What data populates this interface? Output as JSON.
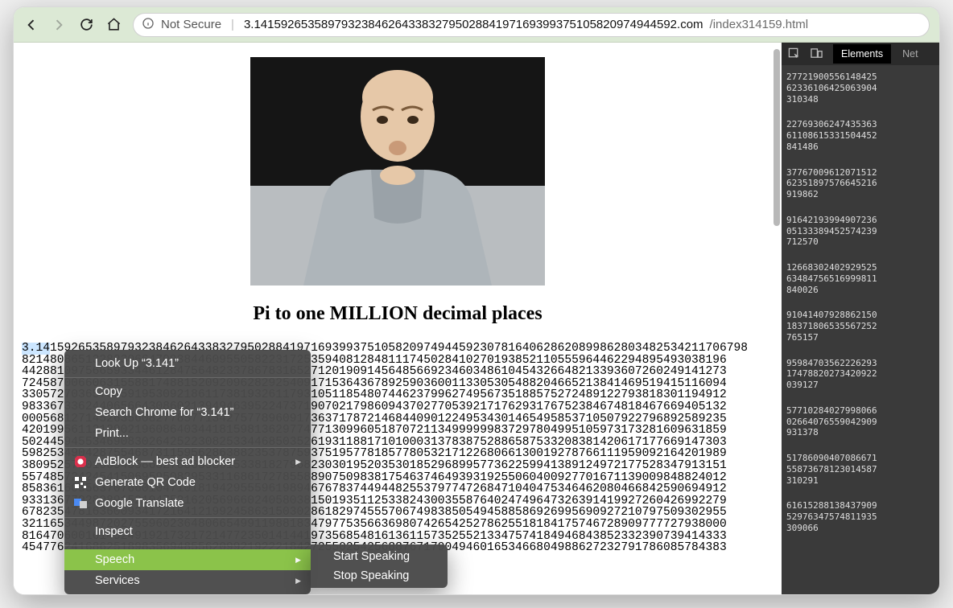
{
  "toolbar": {
    "not_secure": "Not Secure",
    "host": "3.141592653589793238462643383279502884197169399375105820974944592.com",
    "path": "/index314159.html"
  },
  "page": {
    "title": "Pi to one MILLION decimal places",
    "selection": "3.14",
    "digit_rows": [
      "159265358979323846264338327950288419716939937510582097494459230781640628620899862803482534211706798",
      "8214808651328230664709384460955058223172535940812848111745028410270193852110555964462294895493038196",
      "4428810975665933446128475648233786783165271201909145648566923460348610454326648213393607260249141273",
      "7245870066063155881748815209209628292540917153643678925903600113305305488204665213841469519415116094",
      "3305727036575959195309218611738193261179310511854807446237996274956735188575272489122793818301194912",
      "9833673362440656643086021394946395224737190702179860943702770539217176293176752384674818467669405132",
      "0005681271452635608277857713427577896091736371787214684409012249534301465495853710507922796892589235",
      "4201995611212902196086403441815981362977477130996051870721134999999837297804995105973173281609631859",
      "5024459455346908302642522308253344685035261931188171010003137838752886587533208381420617177669147303",
      "5982534904287554687311595628638823537875937519577818577805321712268066130019278766111959092164201989",
      "3809525720106548586327886593615338182796823030195203530185296899577362259941389124972177528347913151",
      "5574857242454150695950829533116861727855889075098381754637464939319255060400927701671139009848824012",
      "8583616035637076601047101819429555961989467678374494482553797747268471040475346462080466842590694912",
      "9331367702898915210475216205696602405803815019351125338243003558764024749647326391419927260426992279",
      "6782354781636009341721641219924586315030286182974555706749838505494588586926995690927210797509302955",
      "3211653449872027559602364806654991198818347977535663698074265425278625518184175746728909777727938000",
      "8164706001614524919217321721477235014144197356854816136115735255213347574184946843852332390739414333",
      "4547762416862518983569485562099219222184272550254256887671790494601653466804988627232791786085784383"
    ]
  },
  "context_menu": {
    "lookup": "Look Up “3.141”",
    "copy": "Copy",
    "search": "Search Chrome for “3.141”",
    "print": "Print...",
    "adblock": "AdBlock — best ad blocker",
    "qr": "Generate QR Code",
    "translate": "Google Translate",
    "inspect": "Inspect",
    "speech": "Speech",
    "services": "Services"
  },
  "speech_submenu": {
    "start": "Start Speaking",
    "stop": "Stop Speaking"
  },
  "devtools": {
    "tab_elements": "Elements",
    "tab_net": "Net",
    "blocks": [
      "27721900556148425\n62336106425063904\n310348",
      "22769306247435363\n61108615331504452\n841486",
      "37767009612071512\n62351897576645216\n919862",
      "91642193994907236\n05133389452574239\n712570",
      "12668302402929525\n63484756516999811\n840026",
      "91041407928862150\n18371806535567252\n765157",
      "95984703562226293\n17478820273420922\n039127",
      "57710284027998066\n02664076559042909\n931378",
      "51786090407086671\n55873678123014587\n310291",
      "61615288138437909\n52976347574811935\n309066"
    ]
  }
}
